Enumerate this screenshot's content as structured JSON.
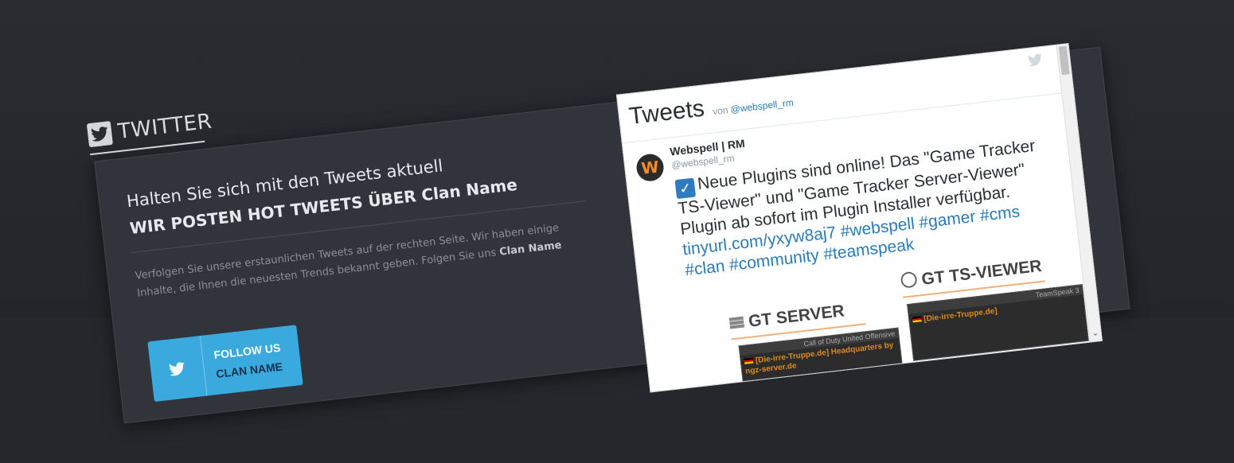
{
  "section": {
    "title": "TWITTER",
    "icon": "twitter-icon"
  },
  "intro": {
    "headline": "Halten Sie sich mit den Tweets aktuell",
    "subheadline": "WIR POSTEN HOT TWEETS ÜBER Clan Name",
    "description_pre": "Verfolgen Sie unsere erstaunlichen Tweets auf der rechten Seite. Wir haben einige Inhalte, die Ihnen die neuesten Trends bekannt geben. Folgen Sie uns ",
    "description_bold": "Clan Name"
  },
  "follow_button": {
    "line1": "FOLLOW US",
    "line2": "CLAN NAME",
    "icon": "twitter-icon"
  },
  "widget": {
    "title": "Tweets",
    "von_label": "von",
    "handle": "@webspell_rm",
    "tweet": {
      "author_name": "Webspell | RM",
      "author_handle": "@webspell_rm",
      "avatar_letter": "W",
      "text": "Neue Plugins sind online! Das \"Game Tracker TS-Viewer\" und \"Game Tracker Server-Viewer\" Plugin ab sofort im Plugin Installer verfügbar.",
      "link_url": "tinyurl.com/yxyw8aj7",
      "hashtags_line1": "#webspell #gamer #cms #clan",
      "hashtags_line2": "#community #teamspeak"
    },
    "media": {
      "server_title": "GT SERVER",
      "ts_title": "GT TS-VIEWER",
      "server_box_bar": "Call of Duty United Offensive",
      "server_box_text": "[Die-irre-Truppe.de] Headquarters by ngz-server.de",
      "ts_box_bar": "TeamSpeak 3",
      "ts_box_text": "[Die-irre-Truppe.de]"
    }
  },
  "colors": {
    "background": "#25272c",
    "panel": "#31343b",
    "accent_blue": "#39a9de",
    "twitter_link": "#2b7bb9"
  }
}
